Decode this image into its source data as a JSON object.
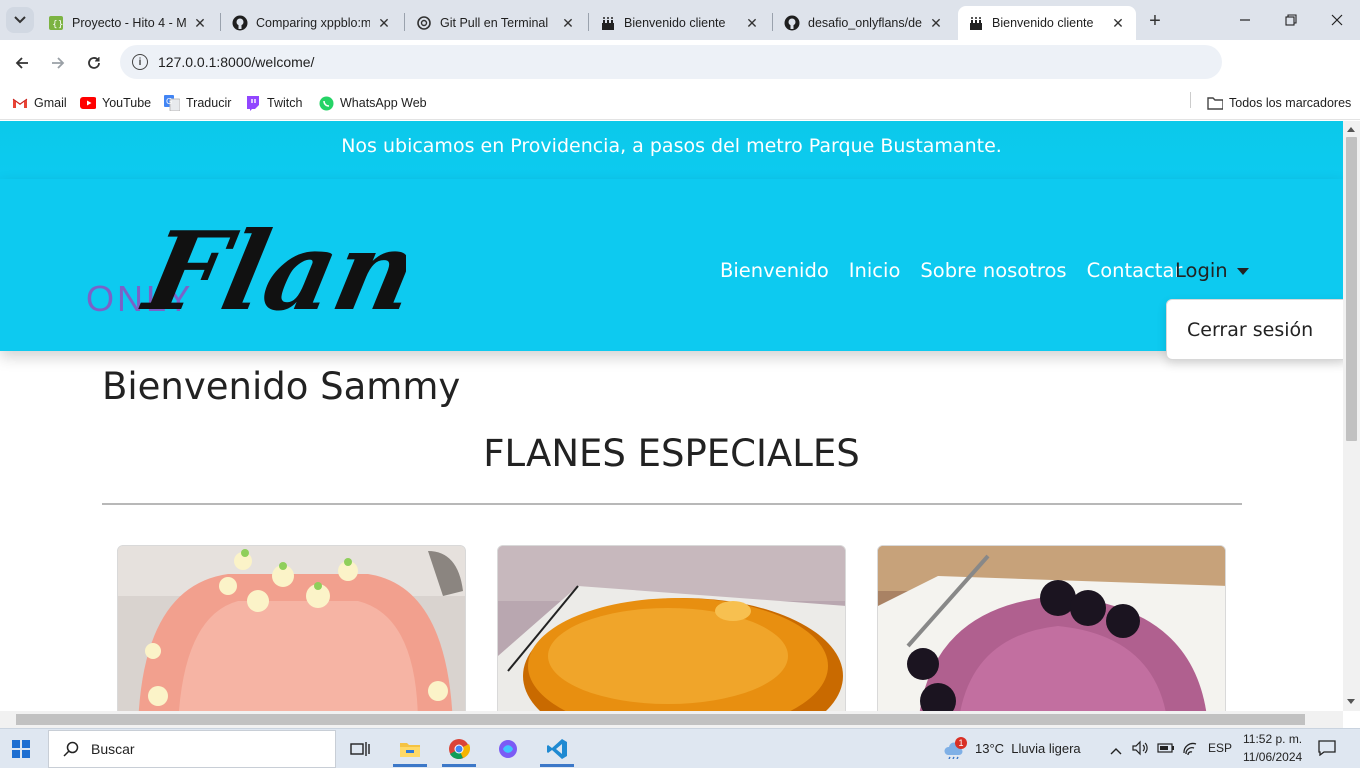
{
  "browser": {
    "tabs": [
      {
        "title": "Proyecto - Hito 4 - M",
        "icon": "project-favicon"
      },
      {
        "title": "Comparing xppblo:m",
        "icon": "github-icon"
      },
      {
        "title": "Git Pull en Terminal",
        "icon": "openai-icon"
      },
      {
        "title": "Bienvenido cliente",
        "icon": "cake-icon"
      },
      {
        "title": "desafio_onlyflans/de",
        "icon": "github-icon"
      },
      {
        "title": "Bienvenido cliente",
        "icon": "cake-icon",
        "active": true
      }
    ],
    "url": "127.0.0.1:8000/welcome/",
    "bookmarks": [
      {
        "label": "Gmail",
        "icon": "gmail-icon"
      },
      {
        "label": "YouTube",
        "icon": "youtube-icon"
      },
      {
        "label": "Traducir",
        "icon": "translate-icon"
      },
      {
        "label": "Twitch",
        "icon": "twitch-icon"
      },
      {
        "label": "WhatsApp Web",
        "icon": "whatsapp-icon"
      }
    ],
    "all_bookmarks": "Todos los marcadores"
  },
  "page": {
    "announcement": "Nos ubicamos en Providencia, a pasos del metro Parque Bustamante.",
    "logo": {
      "small": "ONLY",
      "script": "Flans"
    },
    "nav": [
      "Bienvenido",
      "Inicio",
      "Sobre nosotros",
      "Contactar"
    ],
    "login_label": "Login",
    "dropdown_item": "Cerrar sesión",
    "welcome_heading": "Bienvenido Sammy",
    "section_title": "FLANES ESPECIALES",
    "colors": {
      "primary": "#0dcaf0",
      "heading": "#222222"
    }
  },
  "taskbar": {
    "search_label": "Buscar",
    "weather": "13°C  Lluvia ligera",
    "weather_badge": "1",
    "lang": "ESP",
    "time": "11:52 p. m.",
    "date": "11/06/2024"
  }
}
